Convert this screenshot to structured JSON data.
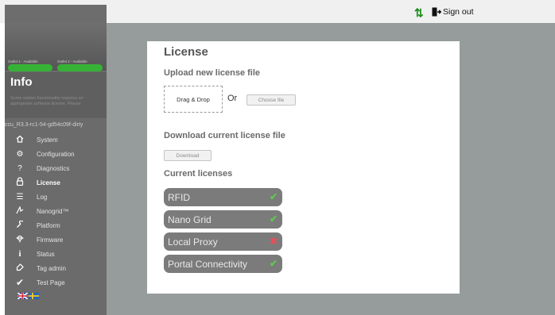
{
  "header": {
    "sign_out": "Sign out",
    "transfer_icon": "up-down-arrows-icon",
    "signout_icon": "door-exit-icon"
  },
  "sidebar": {
    "outlets": [
      {
        "label": "Outlet 1 - Available",
        "color": "#36b336"
      },
      {
        "label": "Outlet 2 - Available",
        "color": "#36b336"
      }
    ],
    "title": "Info",
    "faded_text": "Some station functionality requires an appropriate software license. Please",
    "version": "ccu_R3.3-rc1-54-gd54c09f-dirty",
    "items": [
      {
        "label": "System",
        "icon": "home-icon"
      },
      {
        "label": "Configuration",
        "icon": "gear-icon"
      },
      {
        "label": "Diagnostics",
        "icon": "question-icon"
      },
      {
        "label": "License",
        "icon": "lock-icon",
        "active": true
      },
      {
        "label": "Log",
        "icon": "list-icon"
      },
      {
        "label": "Nanogrid™",
        "icon": "nanogrid-icon"
      },
      {
        "label": "Platform",
        "icon": "wrench-icon"
      },
      {
        "label": "Firmware",
        "icon": "firmware-icon"
      },
      {
        "label": "Status",
        "icon": "info-icon"
      },
      {
        "label": "Tag admin",
        "icon": "tag-icon"
      },
      {
        "label": "Test Page",
        "icon": "check-icon"
      }
    ],
    "languages": [
      "english-flag-icon",
      "swedish-flag-icon"
    ]
  },
  "main": {
    "title": "License",
    "upload_heading": "Upload new license file",
    "drag_drop": "Drag & Drop",
    "or_text": "Or",
    "choose_file": "Choose file",
    "download_heading": "Download current license file",
    "download_button": "Download",
    "current_heading": "Current licenses",
    "licenses": [
      {
        "name": "RFID",
        "valid": true,
        "mark": "✔"
      },
      {
        "name": "Nano Grid",
        "valid": true,
        "mark": "✔"
      },
      {
        "name": "Local Proxy",
        "valid": false,
        "mark": "✖"
      },
      {
        "name": "Portal Connectivity",
        "valid": true,
        "mark": "✔"
      }
    ]
  },
  "colors": {
    "accent_green": "#36b336",
    "valid_green": "#5fc84e",
    "invalid_red": "#e4505a",
    "sidebar_bg": "#6b6b6b",
    "main_bg": "#969b9b"
  }
}
